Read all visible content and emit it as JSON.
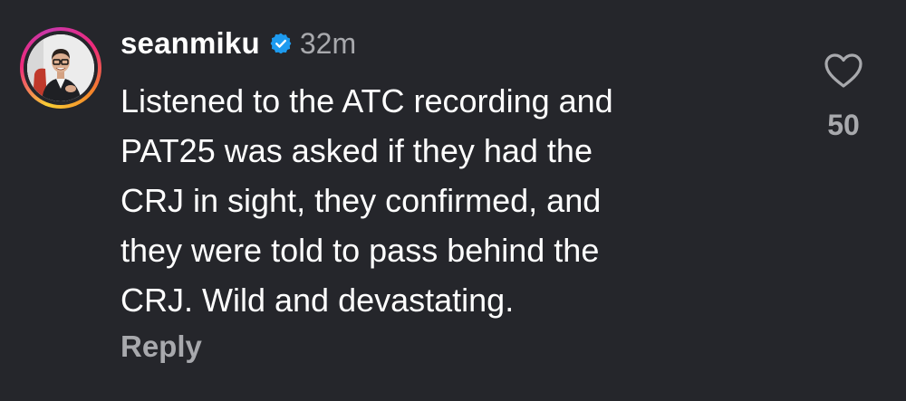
{
  "comment": {
    "username": "seanmiku",
    "verified_icon": "verified-badge-icon",
    "timestamp": "32m",
    "text": "Listened to the ATC recording and\nPAT25 was asked if they had the\nCRJ in sight, they confirmed, and\nthey were told to pass behind the\nCRJ. Wild and devastating.",
    "reply_label": "Reply",
    "like_icon": "heart-icon",
    "like_count": "50"
  },
  "colors": {
    "background": "#25262b",
    "primary_text": "#ffffff",
    "secondary_text": "#a8a9ad",
    "verified_blue": "#1d9bf0"
  }
}
